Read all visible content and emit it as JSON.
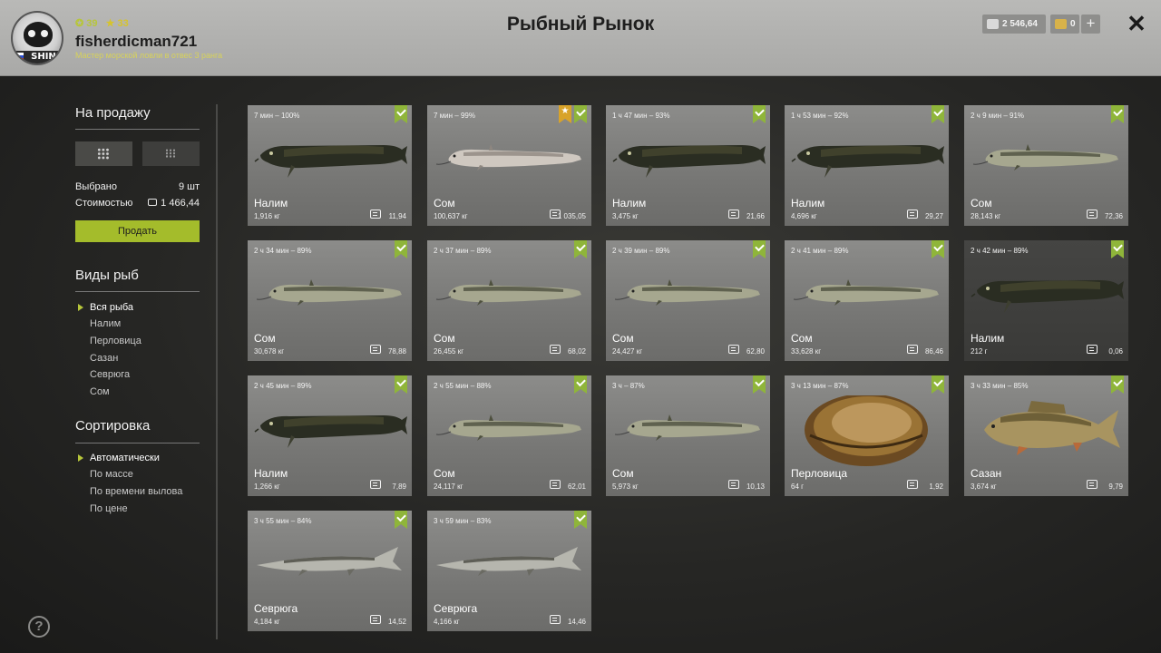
{
  "header": {
    "title": "Рыбный Рынок",
    "logo_text": "SHING",
    "username": "fisherdicman721",
    "rank": "Мастер морской ловли в отвес 3 ранга",
    "level": "39",
    "stars": "33",
    "silver": "2 546,64",
    "gold": "0"
  },
  "sidebar": {
    "sale_title": "На продажу",
    "selected_label": "Выбрано",
    "selected_value": "9 шт",
    "cost_label": "Стоимостью",
    "cost_value": "1 466,44",
    "sell_button": "Продать",
    "types_title": "Виды рыб",
    "types": [
      "Вся рыба",
      "Налим",
      "Перловица",
      "Сазан",
      "Севрюга",
      "Сом"
    ],
    "sort_title": "Сортировка",
    "sorts": [
      "Автоматически",
      "По массе",
      "По времени вылова",
      "По цене"
    ]
  },
  "colors": {
    "accent": "#a4bc2b",
    "check": "#8fb53a",
    "favorite": "#d8a32a"
  },
  "cards": [
    {
      "time": "7 мин – 100%",
      "name": "Налим",
      "weight": "1,916 кг",
      "price": "11,94",
      "fish": "burbot",
      "checked": true
    },
    {
      "time": "7 мин – 99%",
      "name": "Сом",
      "weight": "100,637 кг",
      "price": "1 035,05",
      "fish": "catfish-pale",
      "checked": true,
      "favorite": true
    },
    {
      "time": "1 ч 47 мин – 93%",
      "name": "Налим",
      "weight": "3,475 кг",
      "price": "21,66",
      "fish": "burbot",
      "checked": true
    },
    {
      "time": "1 ч 53 мин – 92%",
      "name": "Налим",
      "weight": "4,696 кг",
      "price": "29,27",
      "fish": "burbot",
      "checked": true
    },
    {
      "time": "2 ч 9 мин – 91%",
      "name": "Сом",
      "weight": "28,143 кг",
      "price": "72,36",
      "fish": "catfish",
      "checked": true
    },
    {
      "time": "2 ч 34 мин – 89%",
      "name": "Сом",
      "weight": "30,678 кг",
      "price": "78,88",
      "fish": "catfish",
      "checked": true
    },
    {
      "time": "2 ч 37 мин – 89%",
      "name": "Сом",
      "weight": "26,455 кг",
      "price": "68,02",
      "fish": "catfish",
      "checked": true
    },
    {
      "time": "2 ч 39 мин – 89%",
      "name": "Сом",
      "weight": "24,427 кг",
      "price": "62,80",
      "fish": "catfish",
      "checked": true
    },
    {
      "time": "2 ч 41 мин – 89%",
      "name": "Сом",
      "weight": "33,628 кг",
      "price": "86,46",
      "fish": "catfish",
      "checked": true
    },
    {
      "time": "2 ч 42 мин – 89%",
      "name": "Налим",
      "weight": "212 г",
      "price": "0,06",
      "fish": "burbot",
      "checked": true,
      "dark": true
    },
    {
      "time": "2 ч 45 мин – 89%",
      "name": "Налим",
      "weight": "1,266 кг",
      "price": "7,89",
      "fish": "burbot",
      "checked": true
    },
    {
      "time": "2 ч 55 мин – 88%",
      "name": "Сом",
      "weight": "24,117 кг",
      "price": "62,01",
      "fish": "catfish",
      "checked": true
    },
    {
      "time": "3 ч – 87%",
      "name": "Сом",
      "weight": "5,973 кг",
      "price": "10,13",
      "fish": "catfish",
      "checked": true
    },
    {
      "time": "3 ч 13 мин – 87%",
      "name": "Перловица",
      "weight": "64 г",
      "price": "1,92",
      "fish": "mussel",
      "checked": true
    },
    {
      "time": "3 ч 33 мин – 85%",
      "name": "Сазан",
      "weight": "3,674 кг",
      "price": "9,79",
      "fish": "carp",
      "checked": true
    },
    {
      "time": "3 ч 55 мин – 84%",
      "name": "Севрюга",
      "weight": "4,184 кг",
      "price": "14,52",
      "fish": "sturgeon",
      "checked": true
    },
    {
      "time": "3 ч 59 мин – 83%",
      "name": "Севрюга",
      "weight": "4,166 кг",
      "price": "14,46",
      "fish": "sturgeon",
      "checked": true
    }
  ]
}
